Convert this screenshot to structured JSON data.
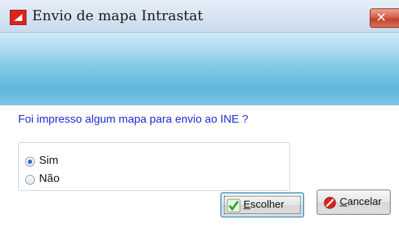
{
  "window": {
    "title": "Envio de mapa Intrastat",
    "app_icon": "app-logo-icon",
    "close_icon": "close-icon",
    "close_glyph": "✕"
  },
  "dialog": {
    "question": "Foi impresso algum mapa para envio ao INE ?",
    "options": [
      {
        "label": "Sim",
        "selected": true
      },
      {
        "label": "Não",
        "selected": false
      }
    ]
  },
  "buttons": {
    "escolher": {
      "label_first": "E",
      "label_rest": "scolher",
      "icon": "checkmark-icon",
      "default": true
    },
    "cancelar": {
      "label_first": "C",
      "label_rest": "ancelar",
      "icon": "cancel-icon"
    }
  },
  "colors": {
    "question_text": "#1a2bd6",
    "header_band": "#7fc3e3",
    "close_button": "#c2432c",
    "app_icon": "#d9261c"
  }
}
